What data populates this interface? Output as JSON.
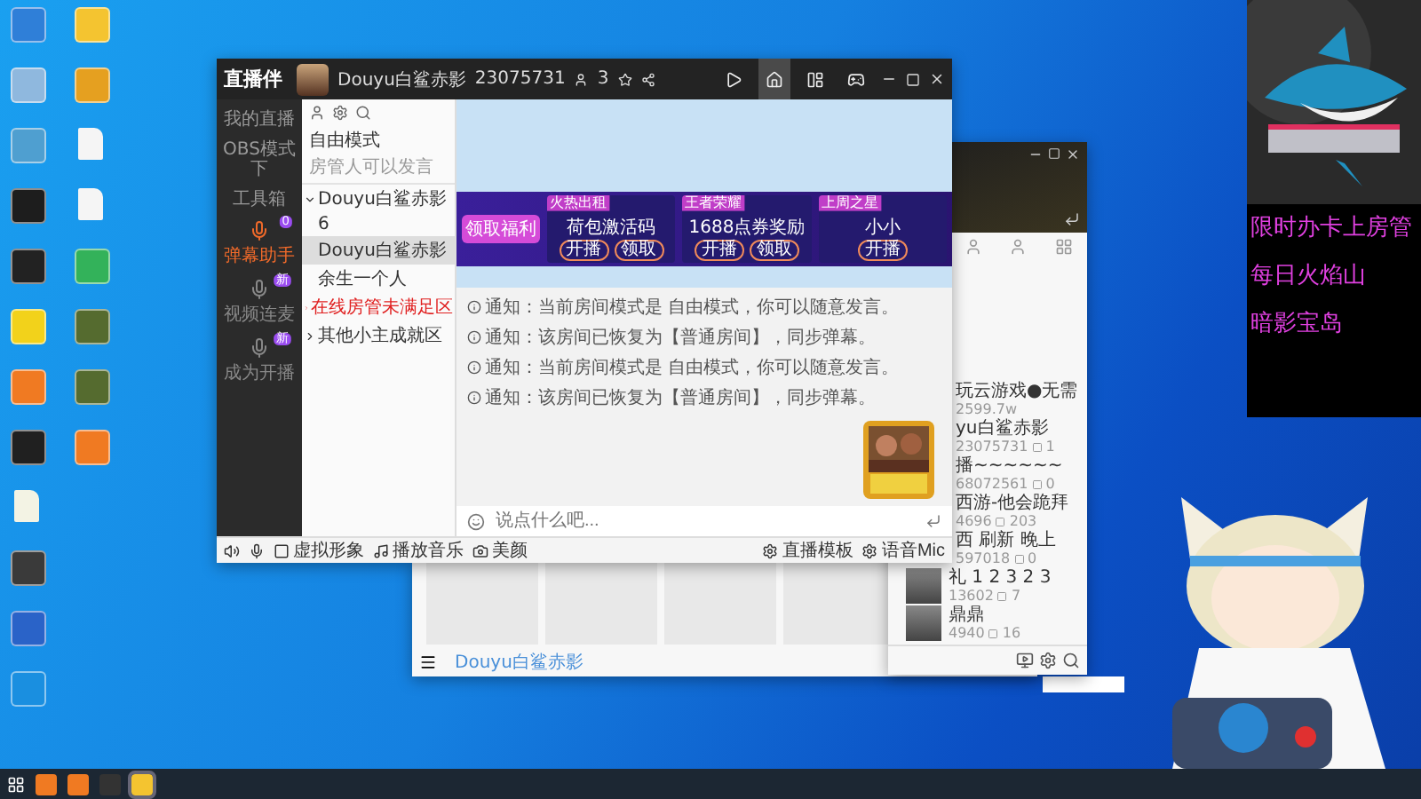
{
  "desktop_icons": [
    {
      "kind": "app",
      "color": "#2f7fd8"
    },
    {
      "kind": "app",
      "color": "#8fb8de"
    },
    {
      "kind": "app",
      "color": "#4f9fd0"
    },
    {
      "kind": "app",
      "color": "#1d1d1d"
    },
    {
      "kind": "app",
      "color": "#222222"
    },
    {
      "kind": "app",
      "color": "#f2d21b"
    },
    {
      "kind": "app",
      "color": "#f07a22"
    },
    {
      "kind": "app",
      "color": "#202020"
    },
    {
      "kind": "document",
      "color": "#f3f3e4"
    },
    {
      "kind": "app",
      "color": "#3a3a3a"
    },
    {
      "kind": "app",
      "color": "#2a63c8"
    },
    {
      "kind": "app",
      "color": "#1a8fe0"
    },
    {
      "kind": "app",
      "color": "#f4c430"
    },
    {
      "kind": "app",
      "color": "#e5a020"
    },
    {
      "kind": "document",
      "color": "#f5f5f5"
    },
    {
      "kind": "document",
      "color": "#f5f5f5"
    },
    {
      "kind": "app",
      "color": "#33b25a"
    },
    {
      "kind": "app",
      "color": "#556b2f"
    },
    {
      "kind": "app",
      "color": "#556b2f"
    },
    {
      "kind": "app",
      "color": "#f07a22"
    }
  ],
  "main_window": {
    "app_name": "直播伴",
    "streamer": "Douyu白鲨赤影",
    "room_id": "23075731",
    "viewers": "3",
    "nav": [
      {
        "kind": "play",
        "selected": false
      },
      {
        "kind": "home",
        "selected": true
      },
      {
        "kind": "panel",
        "selected": false
      },
      {
        "kind": "game",
        "selected": false
      }
    ],
    "rail": {
      "top_label": "我的直播",
      "mode_label": "OBS模式下",
      "section": "工具箱",
      "tools": [
        {
          "label": "弹幕助手",
          "badge": "0",
          "selected": true
        },
        {
          "label": "视频连麦",
          "badge": "新",
          "selected": false
        },
        {
          "label": "成为开播",
          "badge": "新",
          "selected": false
        }
      ]
    },
    "room_panel": {
      "mode": "自由模式",
      "hint": "房管人可以发言",
      "tree": [
        {
          "label": "Douyu白鲨赤影",
          "kind": "normal",
          "expanded": true,
          "selected": false,
          "children": [
            {
              "label": "6",
              "kind": "normal",
              "selected": false
            },
            {
              "label": "Douyu白鲨赤影",
              "kind": "normal",
              "selected": true
            },
            {
              "label": "余生一个人",
              "kind": "normal",
              "selected": false
            }
          ]
        },
        {
          "label": "在线房管未满足区",
          "kind": "alert",
          "expanded": false,
          "selected": false
        },
        {
          "label": "其他小主成就区",
          "kind": "normal",
          "expanded": false,
          "selected": false
        }
      ]
    },
    "banner": {
      "badge": "领取福利",
      "cards": [
        {
          "tag": "火热出租",
          "title": "荷包激活码",
          "buttons": [
            "开播",
            "领取"
          ]
        },
        {
          "tag": "王者荣耀",
          "title": "1688点券奖励",
          "buttons": [
            "开播",
            "领取"
          ]
        },
        {
          "tag": "上周之星",
          "title": "小小",
          "buttons": [
            "开播"
          ]
        }
      ]
    },
    "notices": [
      "通知：当前房间模式是 自由模式，你可以随意发言。",
      "通知：该房间已恢复为【普通房间】，同步弹幕。",
      "通知：当前房间模式是 自由模式，你可以随意发言。",
      "通知：该房间已恢复为【普通房间】，同步弹幕。"
    ],
    "chat_input": {
      "placeholder": "说点什么吧..."
    },
    "toolbar": {
      "left": [
        "虚拟形象",
        "播放音乐",
        "美颜"
      ],
      "right": [
        "直播模板",
        "语音Mic"
      ]
    }
  },
  "list_window": {
    "rows": [
      {
        "kind": "plain",
        "title": "玩云游戏●无需",
        "count": "2599.7w"
      },
      {
        "kind": "plain",
        "title": "yu白鲨赤影",
        "count": "23075731",
        "extra": "1"
      },
      {
        "kind": "plain",
        "title": "播~~~~~~",
        "count": "68072561",
        "extra": "0"
      },
      {
        "kind": "plain",
        "title": "西游-他会跪拜",
        "count": "4696",
        "extra": "203"
      },
      {
        "kind": "plain",
        "title": "西 刷新 晚上",
        "count": "597018",
        "extra": "0"
      },
      {
        "kind": "avatar",
        "title": "礼 1 2 3 2 3",
        "count": "13602",
        "extra": "7"
      },
      {
        "kind": "avatar",
        "title": "鼎鼎",
        "count": "4940",
        "extra": "16"
      }
    ]
  },
  "back_window": {
    "link": "Douyu白鲨赤影"
  },
  "overlay": {
    "lines": [
      "限时办卡上房管",
      "每日火焰山",
      "暗影宝岛"
    ]
  },
  "taskbar": {
    "apps": [
      {
        "color": "#f07a22",
        "selected": false
      },
      {
        "color": "#f07a22",
        "selected": false
      },
      {
        "color": "#333333",
        "selected": false
      },
      {
        "color": "#f4c430",
        "selected": true
      }
    ]
  }
}
